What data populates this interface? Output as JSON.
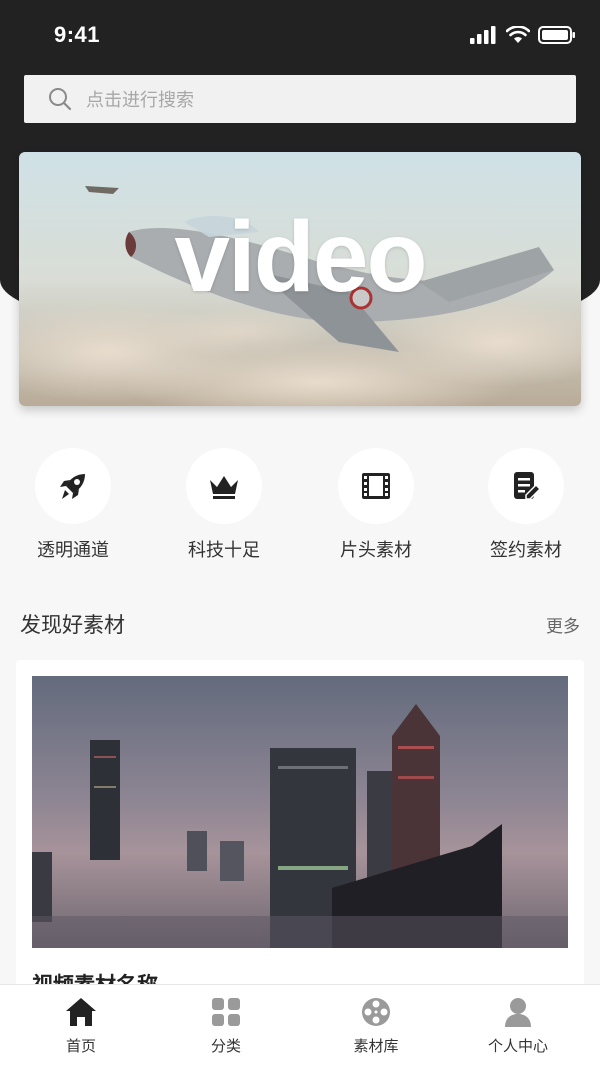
{
  "status_bar": {
    "time": "9:41"
  },
  "search": {
    "placeholder": "点击进行搜索"
  },
  "banner": {
    "title": "video"
  },
  "categories": [
    {
      "label": "透明通道",
      "icon": "rocket-icon"
    },
    {
      "label": "科技十足",
      "icon": "crown-icon"
    },
    {
      "label": "片头素材",
      "icon": "film-icon"
    },
    {
      "label": "签约素材",
      "icon": "document-edit-icon"
    }
  ],
  "section": {
    "title": "发现好素材",
    "more": "更多"
  },
  "card": {
    "title": "视频素材名称"
  },
  "tabbar": {
    "items": [
      {
        "label": "首页",
        "icon": "home-icon",
        "active": true
      },
      {
        "label": "分类",
        "icon": "grid-icon",
        "active": false
      },
      {
        "label": "素材库",
        "icon": "film-reel-icon",
        "active": false
      },
      {
        "label": "个人中心",
        "icon": "user-icon",
        "active": false
      }
    ]
  },
  "colors": {
    "header_bg": "#222222",
    "page_bg": "#f7f7f7",
    "active_tab": "#222222",
    "inactive_tab": "#9a9a9a"
  }
}
